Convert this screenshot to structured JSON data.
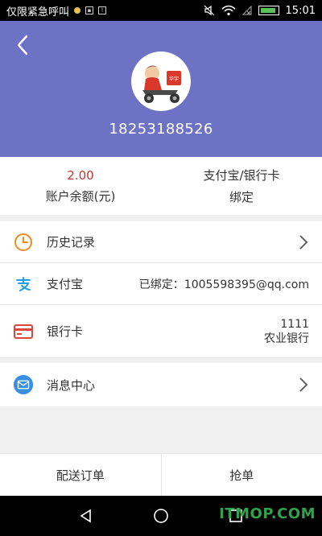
{
  "status_bar": {
    "carrier": "仅限紧急呼叫",
    "time": "15:01"
  },
  "header": {
    "phone": "18253188526",
    "avatar_sign_text": "华宇"
  },
  "balance": {
    "amount": "2.00",
    "amount_label": "账户余额(元)",
    "bind_title": "支付宝/银行卡",
    "bind_label": "绑定"
  },
  "list": {
    "history_label": "历史记录",
    "alipay_label": "支付宝",
    "alipay_value": "已绑定：1005598395@qq.com",
    "bank_label": "银行卡",
    "bank_number": "1111",
    "bank_name": "农业银行",
    "messages_label": "消息中心"
  },
  "tabs": {
    "delivery": "配送订单",
    "grab": "抢单"
  },
  "watermark": "ITMOP.COM",
  "colors": {
    "header_bg": "#6e72c5",
    "amount": "#c23531",
    "history_icon": "#f08a24",
    "alipay_icon": "#1aa0e8",
    "bank_icon": "#e0453a",
    "message_icon": "#3a8ee6"
  },
  "icons": {
    "back": "back-arrow-icon",
    "history": "clock-icon",
    "alipay": "alipay-icon",
    "bank": "card-icon",
    "messages": "envelope-icon"
  }
}
